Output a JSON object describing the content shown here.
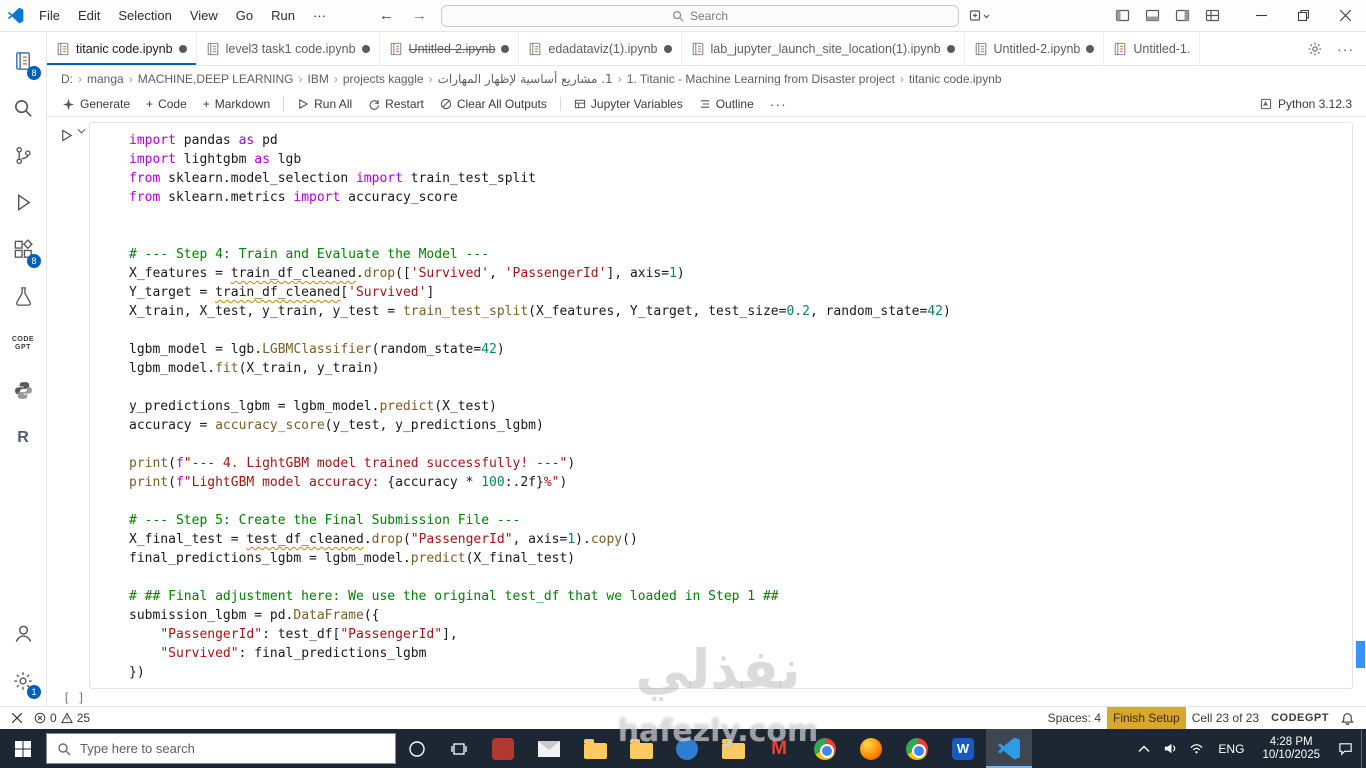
{
  "titlebar": {
    "menus": [
      "File",
      "Edit",
      "Selection",
      "View",
      "Go",
      "Run",
      "···"
    ],
    "search_placeholder": "Search"
  },
  "tabs": [
    {
      "label": "titanic code.ipynb",
      "active": true,
      "dirty": true,
      "strike": false
    },
    {
      "label": "level3 task1 code.ipynb",
      "active": false,
      "dirty": true,
      "strike": false
    },
    {
      "label": "Untitled-2.ipynb",
      "active": false,
      "dirty": true,
      "strike": true
    },
    {
      "label": "edadataviz(1).ipynb",
      "active": false,
      "dirty": true,
      "strike": false
    },
    {
      "label": "lab_jupyter_launch_site_location(1).ipynb",
      "active": false,
      "dirty": true,
      "strike": false
    },
    {
      "label": "Untitled-2.ipynb",
      "active": false,
      "dirty": true,
      "strike": false
    },
    {
      "label": "Untitled-1.",
      "active": false,
      "dirty": false,
      "strike": false
    }
  ],
  "breadcrumbs": [
    "D:",
    "manga",
    "MACHINE,DEEP LEARNING",
    "IBM",
    "projects kaggle",
    "1. مشاريع أساسية لإظهار المهارات",
    "1. Titanic - Machine Learning from Disaster project",
    "titanic code.ipynb"
  ],
  "notebook_toolbar": {
    "generate": "Generate",
    "code": "Code",
    "markdown": "Markdown",
    "run_all": "Run All",
    "restart": "Restart",
    "clear_outputs": "Clear All Outputs",
    "variables": "Jupyter Variables",
    "outline": "Outline",
    "more": "···",
    "kernel": "Python 3.12.3"
  },
  "activity": {
    "badges": {
      "explorer": "8",
      "extensions": "8",
      "settings": "1"
    },
    "codegpt": [
      "CODE",
      "GPT"
    ],
    "r_label": "R"
  },
  "cell": {
    "pending": "[ ]",
    "lines": [
      [
        [
          "k",
          "import"
        ],
        [
          "t",
          " pandas "
        ],
        [
          "k",
          "as"
        ],
        [
          "t",
          " pd"
        ]
      ],
      [
        [
          "k",
          "import"
        ],
        [
          "t",
          " lightgbm "
        ],
        [
          "k",
          "as"
        ],
        [
          "t",
          " lgb"
        ]
      ],
      [
        [
          "k",
          "from"
        ],
        [
          "t",
          " sklearn.model_selection "
        ],
        [
          "k",
          "import"
        ],
        [
          "t",
          " train_test_split"
        ]
      ],
      [
        [
          "k",
          "from"
        ],
        [
          "t",
          " sklearn.metrics "
        ],
        [
          "k",
          "import"
        ],
        [
          "t",
          " accuracy_score"
        ]
      ],
      [],
      [],
      [
        [
          "c",
          "# --- Step 4: Train and Evaluate the Model ---"
        ]
      ],
      [
        [
          "t",
          "X_features = "
        ],
        [
          "w",
          "train_df_cleaned"
        ],
        [
          "t",
          "."
        ],
        [
          "f",
          "drop"
        ],
        [
          "t",
          "(["
        ],
        [
          "s",
          "'Survived'"
        ],
        [
          "t",
          ", "
        ],
        [
          "s",
          "'PassengerId'"
        ],
        [
          "t",
          "], axis="
        ],
        [
          "n",
          "1"
        ],
        [
          "t",
          ")"
        ]
      ],
      [
        [
          "t",
          "Y_target = "
        ],
        [
          "w",
          "train_df_cleaned"
        ],
        [
          "t",
          "["
        ],
        [
          "s",
          "'Survived'"
        ],
        [
          "t",
          "]"
        ]
      ],
      [
        [
          "t",
          "X_train, X_test, y_train, y_test = "
        ],
        [
          "f",
          "train_test_split"
        ],
        [
          "t",
          "(X_features, Y_target, test_size="
        ],
        [
          "n",
          "0.2"
        ],
        [
          "t",
          ", random_state="
        ],
        [
          "n",
          "42"
        ],
        [
          "t",
          ")"
        ]
      ],
      [],
      [
        [
          "t",
          "lgbm_model = lgb."
        ],
        [
          "f",
          "LGBMClassifier"
        ],
        [
          "t",
          "(random_state="
        ],
        [
          "n",
          "42"
        ],
        [
          "t",
          ")"
        ]
      ],
      [
        [
          "t",
          "lgbm_model."
        ],
        [
          "f",
          "fit"
        ],
        [
          "t",
          "(X_train, y_train)"
        ]
      ],
      [],
      [
        [
          "t",
          "y_predictions_lgbm = lgbm_model."
        ],
        [
          "f",
          "predict"
        ],
        [
          "t",
          "(X_test)"
        ]
      ],
      [
        [
          "t",
          "accuracy = "
        ],
        [
          "f",
          "accuracy_score"
        ],
        [
          "t",
          "(y_test, y_predictions_lgbm)"
        ]
      ],
      [],
      [
        [
          "f",
          "print"
        ],
        [
          "t",
          "("
        ],
        [
          "k",
          "f"
        ],
        [
          "s",
          "\"--- 4. LightGBM model trained successfully! ---\""
        ],
        [
          "t",
          ")"
        ]
      ],
      [
        [
          "f",
          "print"
        ],
        [
          "t",
          "("
        ],
        [
          "k",
          "f"
        ],
        [
          "s",
          "\"LightGBM model accuracy: "
        ],
        [
          "t",
          "{accuracy * "
        ],
        [
          "n",
          "100"
        ],
        [
          "t",
          ":.2f}"
        ],
        [
          "s",
          "%\""
        ],
        [
          "t",
          ")"
        ]
      ],
      [],
      [
        [
          "c",
          "# --- Step 5: Create the Final Submission File ---"
        ]
      ],
      [
        [
          "t",
          "X_final_test = "
        ],
        [
          "w",
          "test_df_cleaned"
        ],
        [
          "t",
          "."
        ],
        [
          "f",
          "drop"
        ],
        [
          "t",
          "("
        ],
        [
          "s",
          "\"PassengerId\""
        ],
        [
          "t",
          ", axis="
        ],
        [
          "n",
          "1"
        ],
        [
          "t",
          ")."
        ],
        [
          "f",
          "copy"
        ],
        [
          "t",
          "()"
        ]
      ],
      [
        [
          "t",
          "final_predictions_lgbm = lgbm_model."
        ],
        [
          "f",
          "predict"
        ],
        [
          "t",
          "(X_final_test)"
        ]
      ],
      [],
      [
        [
          "c",
          "# ## Final adjustment here: We use the original test_df that we loaded in Step 1 ##"
        ]
      ],
      [
        [
          "t",
          "submission_lgbm = pd."
        ],
        [
          "f",
          "DataFrame"
        ],
        [
          "t",
          "({"
        ]
      ],
      [
        [
          "t",
          "    "
        ],
        [
          "s",
          "\"PassengerId\""
        ],
        [
          "t",
          ": test_df["
        ],
        [
          "s",
          "\"PassengerId\""
        ],
        [
          "t",
          "],"
        ]
      ],
      [
        [
          "t",
          "    "
        ],
        [
          "s",
          "\"Survived\""
        ],
        [
          "t",
          ": final_predictions_lgbm"
        ]
      ],
      [
        [
          "t",
          "})"
        ]
      ]
    ]
  },
  "statusbar": {
    "errors": "0",
    "warnings": "25",
    "spaces": "Spaces: 4",
    "finish_setup": "Finish Setup",
    "cell_position": "Cell 23 of 23",
    "brand": "CODEGPT"
  },
  "taskbar": {
    "search_placeholder": "Type here to search",
    "lang": "ENG",
    "time": "4:28 PM",
    "date": "10/10/2025",
    "apps": [
      {
        "name": "app-red",
        "shape": "square",
        "color": "#b03a30",
        "glyph": ""
      },
      {
        "name": "mail",
        "shape": "envelope",
        "glyph": ""
      },
      {
        "name": "file-explorer",
        "shape": "folder",
        "glyph": ""
      },
      {
        "name": "folder-2",
        "shape": "folder",
        "glyph": ""
      },
      {
        "name": "app-blue",
        "shape": "circle",
        "color": "#2d7dd2",
        "glyph": ""
      },
      {
        "name": "folder-3",
        "shape": "folder",
        "glyph": ""
      },
      {
        "name": "gmail",
        "shape": "gmail",
        "glyph": "M"
      },
      {
        "name": "chrome",
        "shape": "chrome",
        "glyph": ""
      },
      {
        "name": "firefox",
        "shape": "firefox",
        "glyph": ""
      },
      {
        "name": "chrome-2",
        "shape": "chrome",
        "glyph": ""
      },
      {
        "name": "word",
        "shape": "square",
        "color": "#185abd",
        "glyph": "W"
      },
      {
        "name": "vscode",
        "shape": "vscode",
        "glyph": "",
        "active": true
      }
    ]
  },
  "watermark": {
    "line1": "نفذلي",
    "line2": "hafezly.com"
  }
}
